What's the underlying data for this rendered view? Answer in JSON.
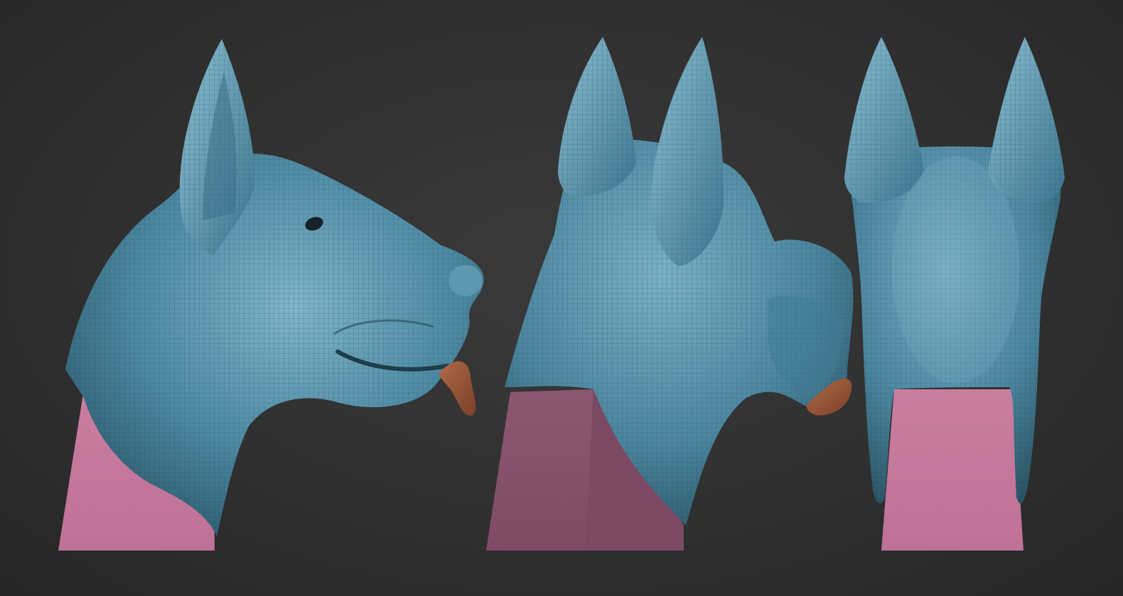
{
  "scene": {
    "background_color": "#2f2f2f",
    "mesh_color": "#4f8aa3",
    "mesh_highlight": "#7db6cc",
    "mesh_shadow": "#2b5366",
    "pedestal_color": "#c47a9a",
    "pedestal_shadow": "#8a4f6a",
    "tongue_color": "#9a5a3c",
    "views": [
      {
        "id": "side",
        "description": "dog-head-side-view"
      },
      {
        "id": "three-quarter-back",
        "description": "dog-head-three-quarter-back-view"
      },
      {
        "id": "back",
        "description": "dog-head-back-view"
      }
    ]
  }
}
